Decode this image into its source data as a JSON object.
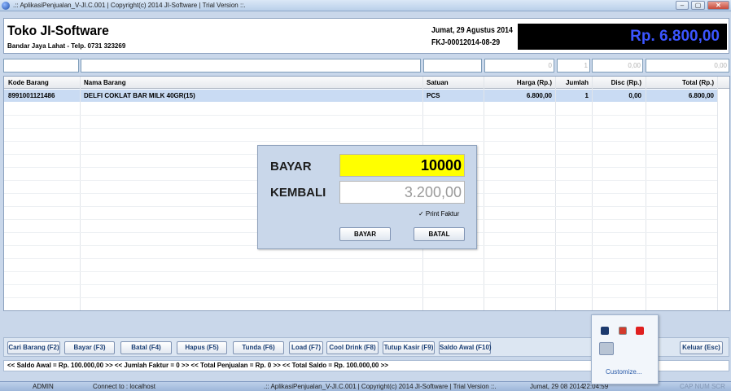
{
  "window": {
    "title": ".:: AplikasiPenjualan_V-JI.C.001  |  Copyright(c) 2014 JI-Software  |  Trial Version ::.",
    "minimize": "–",
    "maximize": "▢",
    "close": "✕"
  },
  "header": {
    "shop_name": "Toko JI-Software",
    "address": "Bandar Jaya Lahat - Telp. 0731 323269",
    "date": "Jumat, 29 Agustus 2014",
    "invoice": "FKJ-00012014-08-29",
    "total_display": "Rp.  6.800,00"
  },
  "inputs": {
    "harga": "0",
    "jumlah": "1",
    "disc": "0,00",
    "total": "0,00"
  },
  "table": {
    "columns": [
      "Kode Barang",
      "Nama Barang",
      "Satuan",
      "Harga (Rp.)",
      "Jumlah",
      "Disc (Rp.)",
      "Total (Rp.)"
    ],
    "rows": [
      [
        "8991001121486",
        "DELFI COKLAT BAR MILK 40GR(15)",
        "PCS",
        "6.800,00",
        "1",
        "0,00",
        "6.800,00"
      ]
    ]
  },
  "dialog": {
    "bayar_label": "BAYAR",
    "bayar_value": "10000",
    "kembali_label": "KEMBALI",
    "kembali_value": "3.200,00",
    "print_faktur": "✓ Print Faktur",
    "bayar_button": "BAYAR",
    "batal_button": "BATAL"
  },
  "toolbar": {
    "buttons": [
      "Cari Barang (F2)",
      "Bayar (F3)",
      "Batal (F4)",
      "Hapus (F5)",
      "Tunda (F6)",
      "Load (F7)",
      "Cool Drink (F8)",
      "Tutup Kasir (F9)",
      "Saldo Awal (F10)"
    ],
    "keluar": "Keluar (Esc)"
  },
  "summary": "<< Saldo Awal = Rp. 100.000,00 >>   << Jumlah Faktur = 0 >>   << Total Penjualan = Rp. 0 >>   << Total Saldo = Rp. 100.000,00 >>",
  "status": {
    "user": "ADMIN",
    "connection": "Connect to : localhost",
    "title": ".:: AplikasiPenjualan_V-JI.C.001  |  Copyright(c) 2014 JI-Software  |  Trial Version ::.",
    "date": "Jumat, 29 08 2014",
    "time": "22:04:59",
    "indicators": "CAP  NUM  SCR"
  },
  "tray": {
    "customize": "Customize..."
  },
  "colors": {
    "accent_blue": "#3b55ff",
    "bayar_yellow": "#ffff00",
    "selected_row": "#c9dbf3"
  }
}
